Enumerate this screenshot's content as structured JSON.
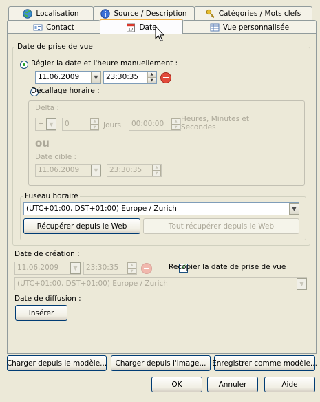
{
  "tabs_row1": [
    {
      "label": "Localisation",
      "icon": "globe-icon"
    },
    {
      "label": "Source / Description",
      "icon": "info-icon"
    },
    {
      "label": "Catégories / Mots clefs",
      "icon": "key-icon"
    }
  ],
  "tabs_row2": [
    {
      "label": "Contact",
      "icon": "contact-card-icon"
    },
    {
      "label": "Date",
      "icon": "calendar-icon"
    },
    {
      "label": "Vue personnalisée",
      "icon": "table-view-icon"
    }
  ],
  "capture": {
    "legend": "Date de prise de vue",
    "manual_radio": "Régler la date et l'heure manuellement :",
    "manual_date": "11.06.2009",
    "manual_time": "23:30:35",
    "offset_radio": "Décallage horaire :",
    "delta_label": "Delta :",
    "delta_sign": "+",
    "delta_days": "0",
    "days_label": "Jours",
    "delta_hms": "00:00:00",
    "hms_label": "Heures, Minutes et Secondes",
    "or_label": "ou",
    "target_label": "Date cible :",
    "target_date": "11.06.2009",
    "target_time": "23:30:35"
  },
  "timezone": {
    "legend": "Fuseau horaire",
    "selected": "(UTC+01:00, DST+01:00) Europe / Zurich",
    "fetch_button": "Récupérer depuis le Web",
    "fetch_all_button": "Tout récupérer depuis le Web"
  },
  "creation": {
    "label": "Date de création :",
    "date": "11.06.2009",
    "time": "23:30:35",
    "copy_checkbox": "Recopier la date de prise de vue",
    "timezone": "(UTC+01:00, DST+01:00) Europe / Zurich"
  },
  "broadcast": {
    "label": "Date de diffusion :",
    "insert_button": "Insérer"
  },
  "footer": {
    "load_template": "Charger depuis le modèle...",
    "load_image": "Charger depuis l'image...",
    "save_template": "Enregistrer comme modèle...",
    "ok": "OK",
    "cancel": "Annuler",
    "help": "Aide"
  },
  "colors": {
    "accent_tab": "#f5b041",
    "xp_border": "#003c74",
    "delete_red": "#e24a3b"
  }
}
